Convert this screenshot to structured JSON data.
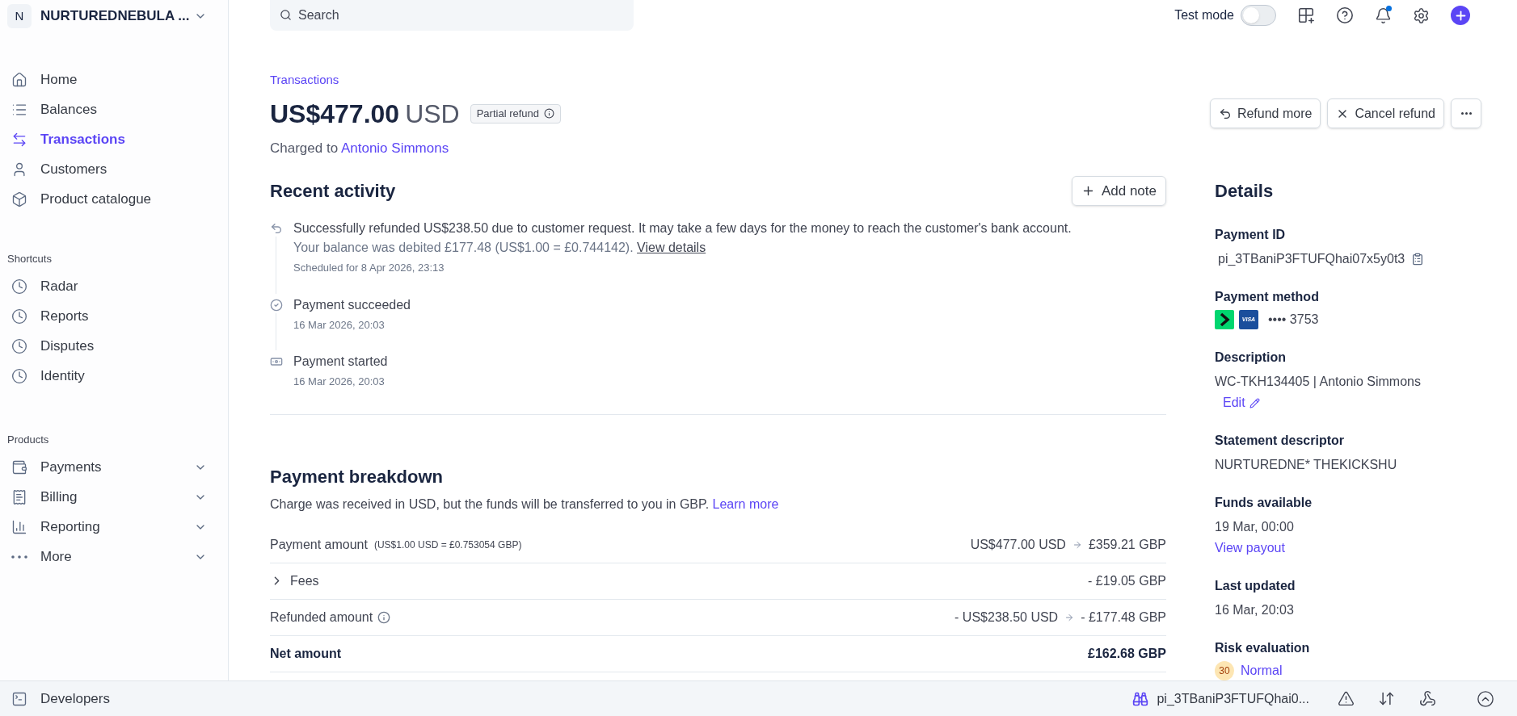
{
  "account": {
    "initial": "N",
    "name": "NURTUREDNEBULA ..."
  },
  "sidebar": {
    "items": [
      {
        "label": "Home",
        "selected": false
      },
      {
        "label": "Balances",
        "selected": false
      },
      {
        "label": "Transactions",
        "selected": true
      },
      {
        "label": "Customers",
        "selected": false
      },
      {
        "label": "Product catalogue",
        "selected": false
      }
    ],
    "sections": [
      {
        "title": "Shortcuts",
        "items": [
          {
            "label": "Radar"
          },
          {
            "label": "Reports"
          },
          {
            "label": "Disputes"
          },
          {
            "label": "Identity"
          }
        ]
      },
      {
        "title": "Products",
        "items": [
          {
            "label": "Payments",
            "expanded": false
          },
          {
            "label": "Billing",
            "expanded": false
          },
          {
            "label": "Reporting",
            "expanded": false
          },
          {
            "label": "More",
            "expanded": false
          }
        ]
      }
    ]
  },
  "topbar": {
    "search": {
      "placeholder": "Search"
    },
    "test_mode": {
      "label": "Test mode",
      "on": false
    },
    "notifications": {
      "unread": true
    }
  },
  "header": {
    "breadcrumb": "Transactions",
    "amount": "US$477.00",
    "currency": "USD",
    "badge": "Partial refund",
    "charged_prefix": "Charged to",
    "customer": "Antonio Simmons",
    "actions": [
      {
        "label": "Refund more"
      },
      {
        "label": "Cancel refund"
      }
    ]
  },
  "recent_activity": {
    "title": "Recent activity",
    "add_note": "Add note",
    "items": [
      {
        "kind": "refund",
        "text": "Successfully refunded US$238.50 due to customer request. It may take a few days for the money to reach the customer's bank account.",
        "note": "Your balance was debited £177.48 (US$1.00 = £0.744142).",
        "link": "View details",
        "time": "Scheduled for 8 Apr 2026, 23:13"
      },
      {
        "kind": "succeeded",
        "text": "Payment succeeded",
        "time": "16 Mar 2026, 20:03"
      },
      {
        "kind": "started",
        "text": "Payment started",
        "time": "16 Mar 2026, 20:03"
      }
    ]
  },
  "breakdown": {
    "title": "Payment breakdown",
    "subtitle": "Charge was received in USD, but the funds will be transferred to you in GBP.",
    "link": "Learn more",
    "rows": [
      {
        "kind": "amount",
        "label": "Payment amount",
        "note": "(US$1.00 USD = £0.753054 GBP)",
        "from": "US$477.00 USD",
        "value": "£359.21 GBP"
      },
      {
        "kind": "fees",
        "label": "Fees",
        "expanded": false,
        "value": "- £19.05 GBP"
      },
      {
        "kind": "refund",
        "label": "Refunded amount",
        "from": "- US$238.50 USD",
        "value": "- £177.48 GBP"
      },
      {
        "kind": "total",
        "label": "Net amount",
        "value": "£162.68 GBP"
      }
    ]
  },
  "details": {
    "title": "Details",
    "fields": [
      {
        "kind": "copy",
        "label": "Payment ID",
        "value": "pi_3TBaniP3FTUFQhai07x5y0t3"
      },
      {
        "kind": "card",
        "label": "Payment method",
        "brand": "VISA",
        "value": "•••• 3753"
      },
      {
        "kind": "editable",
        "label": "Description",
        "value": "WC-TKH134405 | Antonio Simmons",
        "link": "Edit"
      },
      {
        "kind": "text",
        "label": "Statement descriptor",
        "value": "NURTUREDNE* THEKICKSHU"
      },
      {
        "kind": "link",
        "label": "Funds available",
        "value": "19 Mar, 00:00",
        "link": "View payout"
      },
      {
        "kind": "text",
        "label": "Last updated",
        "value": "16 Mar, 20:03"
      },
      {
        "kind": "risk",
        "label": "Risk evaluation",
        "score": "30",
        "value": "Normal"
      }
    ]
  },
  "bottom_bar": {
    "developers": "Developers",
    "search_id": "pi_3TBaniP3FTUFQhai0..."
  }
}
